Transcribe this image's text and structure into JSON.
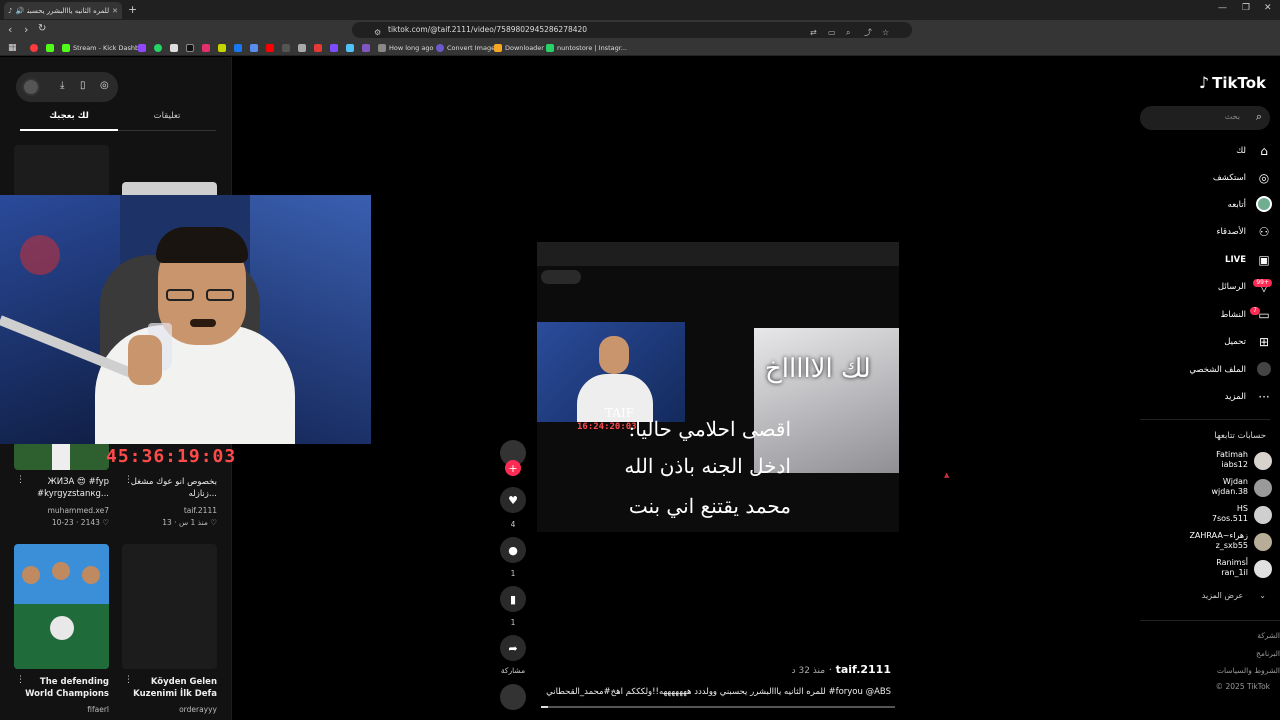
{
  "browser": {
    "tab_title": "للمره الثانيه يااالبشرر يحسبني وا",
    "url": "tiktok.com/@taif.2111/video/7589802945286278420",
    "bookmarks": [
      "Stream - Kick Dashb...",
      "How long ago",
      "Convert Image",
      "Downloader",
      "nuntostore | Instagr..."
    ],
    "extension_badge_count": "1"
  },
  "left_panel": {
    "tabs": {
      "comments": "تعليقات",
      "for_you": "لك بعجبك"
    },
    "cards": [
      {
        "title": "ЖИЗА 😍 #fyp #kyrgyzstanкg...",
        "author": "muhammed.xe7",
        "likes": "2143",
        "date": "10-23"
      },
      {
        "title": "بخصوص انو عوك مشغل زنازله...",
        "author": "taif.2111",
        "likes": "13",
        "date": "منذ 1 س"
      },
      {
        "title": "The defending World Champions",
        "author": "fifaerl"
      },
      {
        "title": "Köyden Gelen Kuzenimi İlk Defa",
        "author": "orderayyy"
      }
    ]
  },
  "overlay": {
    "timer": "45:36:19:03"
  },
  "video": {
    "overlay_lines": [
      "اقصى احلامي حاليا:",
      "ادخل الجنه باذن الله",
      "محمد يقتنع اني بنت"
    ],
    "sticker_text": "لك الاااااخ",
    "inner_label": "TAIF",
    "inner_time": "16:24:20:03",
    "author": "taif.2111",
    "time_ago": "منذ 32 د",
    "caption": "للمره الثانيه يااالبشرر يحسبني وولددد هههههههه!!ولكككم اهخ#محمد_القحطاني #foryou @ABS",
    "progress": 0.02
  },
  "actions": {
    "likes": "4",
    "comments": "1",
    "saves": "1",
    "share_label": "مشاركة"
  },
  "sidebar": {
    "logo": "TikTok",
    "search_placeholder": "بحث",
    "nav": [
      "لك",
      "استكشف",
      "أتابعه",
      "الأصدقاء",
      "LIVE",
      "الرسائل",
      "النشاط",
      "تحميل",
      "الملف الشخصي",
      "المزيد"
    ],
    "messages_badge": "99+",
    "activity_badge": "7",
    "following_header": "حسابات تتابعها",
    "following": [
      {
        "name": "Fatimah",
        "handle": "iabs12"
      },
      {
        "name": "Wjdan",
        "handle": "wjdan.38"
      },
      {
        "name": "HS",
        "handle": "7sos.511"
      },
      {
        "name": "ZAHRAA~زهراء",
        "handle": "z_sxb55"
      },
      {
        "name": "Ranimsأ",
        "handle": "ran_1il"
      }
    ],
    "see_more": "عرض المزيد",
    "footer": [
      "الشركة",
      "البرنامج",
      "الشروط والسياسات",
      "© 2025 TikTok"
    ]
  }
}
